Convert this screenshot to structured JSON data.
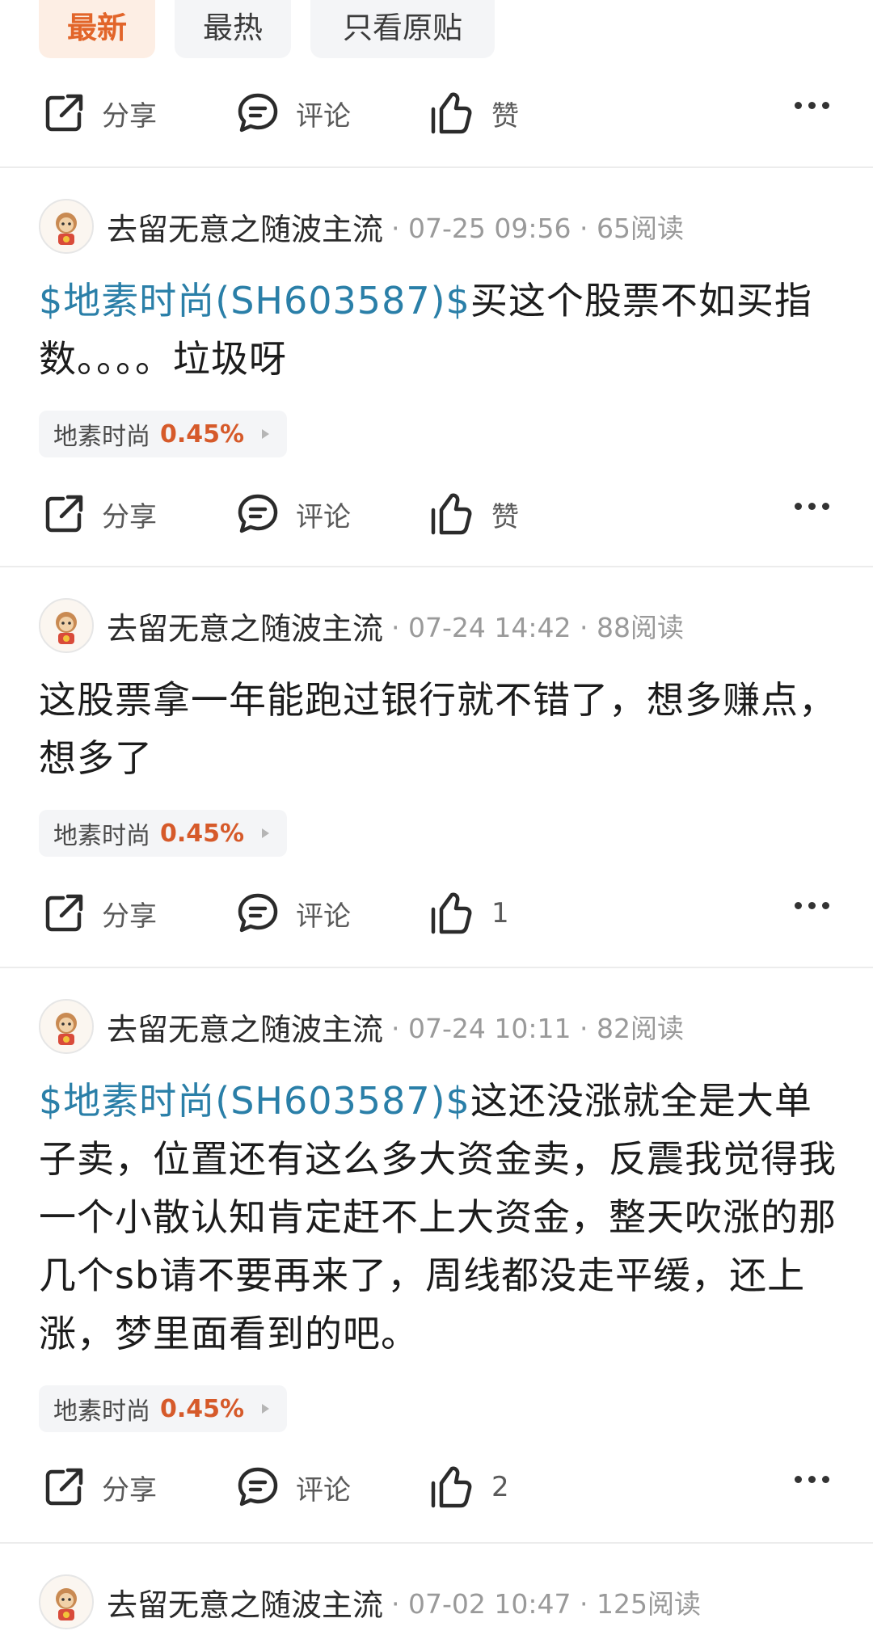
{
  "tabs": [
    {
      "label": "最新",
      "active": true
    },
    {
      "label": "最热",
      "active": false
    },
    {
      "label": "只看原贴",
      "active": false
    }
  ],
  "actions": {
    "share": "分享",
    "comment": "评论",
    "like": "赞"
  },
  "posts": [
    {
      "user": "去留无意之随波主流",
      "time": "07-25 09:56",
      "reads": "65阅读",
      "stock_tag": "$地素时尚(SH603587)$",
      "text": "买这个股票不如买指数。。。。垃圾呀",
      "chip": {
        "name": "地素时尚",
        "change": "0.45%"
      },
      "likes": "赞"
    },
    {
      "user": "去留无意之随波主流",
      "time": "07-24 14:42",
      "reads": "88阅读",
      "stock_tag": "",
      "text": "这股票拿一年能跑过银行就不错了，想多赚点，想多了",
      "chip": {
        "name": "地素时尚",
        "change": "0.45%"
      },
      "likes": "1"
    },
    {
      "user": "去留无意之随波主流",
      "time": "07-24 10:11",
      "reads": "82阅读",
      "stock_tag": "$地素时尚(SH603587)$",
      "text": "这还没涨就全是大单子卖，位置还有这么多大资金卖，反震我觉得我一个小散认知肯定赶不上大资金，整天吹涨的那几个sb请不要再来了，周线都没走平缓，还上涨，梦里面看到的吧。",
      "chip": {
        "name": "地素时尚",
        "change": "0.45%"
      },
      "likes": "2"
    },
    {
      "user": "去留无意之随波主流",
      "time": "07-02 10:47",
      "reads": "125阅读"
    }
  ],
  "colors": {
    "accent": "#e2652a",
    "link": "#2a7fa8",
    "positive": "#d65a2a"
  }
}
